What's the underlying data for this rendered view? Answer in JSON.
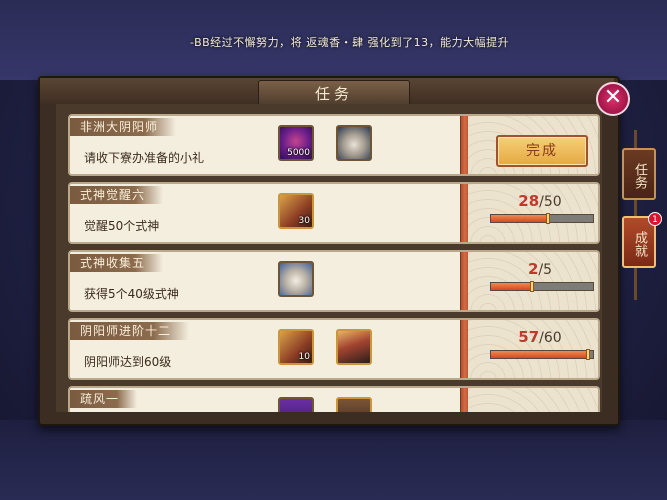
{
  "notice": "-BB经过不懈努力，将 返魂香・肆 强化到了13，能力大幅提升",
  "panel": {
    "title": "任务"
  },
  "close_symbol": "✕",
  "side_tabs": [
    {
      "label": "任务",
      "active": false
    },
    {
      "label": "成就",
      "active": true,
      "badge": "1"
    }
  ],
  "tasks": [
    {
      "name": "非洲大阴阳师",
      "desc": "请收下寮办准备的小礼",
      "rewards": [
        {
          "icon": "jade-icon",
          "count": "5000"
        },
        {
          "icon": "daruma-icon",
          "count": ""
        }
      ],
      "status": "complete",
      "button_label": "完成"
    },
    {
      "name": "式神觉醒六",
      "desc": "觉醒50个式神",
      "rewards": [
        {
          "icon": "ticket-icon",
          "count": "30"
        }
      ],
      "progress": {
        "current": "28",
        "total": "/50",
        "fraction": 0.56
      }
    },
    {
      "name": "式神收集五",
      "desc": "获得5个40级式神",
      "rewards": [
        {
          "icon": "daruma-icon",
          "count": ""
        }
      ],
      "progress": {
        "current": "2",
        "total": "/5",
        "fraction": 0.4
      }
    },
    {
      "name": "阴阳师进阶十二",
      "desc": "阴阳师达到60级",
      "rewards": [
        {
          "icon": "ticket-icon",
          "count": "10"
        },
        {
          "icon": "shikigami-avatar-icon",
          "count": ""
        }
      ],
      "progress": {
        "current": "57",
        "total": "/60",
        "fraction": 0.95
      }
    },
    {
      "name": "疏风一",
      "desc": "",
      "rewards": [
        {
          "icon": "purple-item-icon",
          "count": ""
        },
        {
          "icon": "brown-item-icon",
          "count": ""
        }
      ]
    }
  ]
}
